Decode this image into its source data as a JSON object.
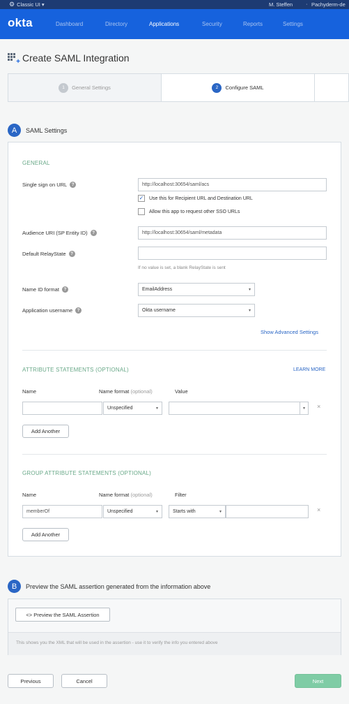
{
  "topbar": {
    "classic_label": "Classic UI ▾",
    "user": "M. Steffen",
    "separator": "·",
    "org": "Pachyderm-de"
  },
  "nav": {
    "logo": "okta",
    "items": [
      {
        "label": "Dashboard",
        "active": false
      },
      {
        "label": "Directory",
        "active": false
      },
      {
        "label": "Applications",
        "active": true
      },
      {
        "label": "Security",
        "active": false
      },
      {
        "label": "Reports",
        "active": false
      },
      {
        "label": "Settings",
        "active": false
      }
    ]
  },
  "page": {
    "title": "Create SAML Integration"
  },
  "steps": [
    {
      "num": "1",
      "label": "General Settings"
    },
    {
      "num": "2",
      "label": "Configure SAML"
    }
  ],
  "section_a": {
    "letter": "A",
    "label": "SAML Settings"
  },
  "general": {
    "title": "GENERAL",
    "sso_url_label": "Single sign on URL",
    "sso_url_value": "http://localhost:30654/saml/acs",
    "checkbox1_label": "Use this for Recipient URL and Destination URL",
    "checkbox1_mark": "✓",
    "checkbox2_label": "Allow this app to request other SSO URLs",
    "audience_label": "Audience URI (SP Entity ID)",
    "audience_value": "http://localhost:30654/saml/metadata",
    "relay_label": "Default RelayState",
    "relay_value": "",
    "relay_hint": "If no value is set, a blank RelayState is sent",
    "nameid_label": "Name ID format",
    "nameid_value": "EmailAddress",
    "appuser_label": "Application username",
    "appuser_value": "Okta username",
    "advanced_link": "Show Advanced Settings",
    "help_glyph": "?"
  },
  "attributes": {
    "title": "ATTRIBUTE STATEMENTS (OPTIONAL)",
    "learn_more": "LEARN MORE",
    "col_name": "Name",
    "col_format": "Name format",
    "col_format_opt": "(optional)",
    "col_value": "Value",
    "row_name": "",
    "row_format": "Unspecified",
    "row_value": "",
    "remove_glyph": "×",
    "add_another": "Add Another"
  },
  "group_attributes": {
    "title": "GROUP ATTRIBUTE STATEMENTS (OPTIONAL)",
    "col_name": "Name",
    "col_format": "Name format",
    "col_format_opt": "(optional)",
    "col_filter": "Filter",
    "row_name": "memberOf",
    "row_format": "Unspecified",
    "row_filter_type": "Starts with",
    "row_filter_value": "",
    "remove_glyph": "×",
    "add_another": "Add Another"
  },
  "section_b": {
    "letter": "B",
    "label": "Preview the SAML assertion generated from the information above",
    "preview_button": "<> Preview the SAML Assertion",
    "note": "This shows you the XML that will be used in the assertion - use it to verify the info you entered above"
  },
  "footer": {
    "previous": "Previous",
    "cancel": "Cancel",
    "next": "Next"
  },
  "colors": {
    "nav_bg": "#1662dd",
    "topbar_bg": "#1d3b73",
    "accent_blue": "#2a66c5",
    "section_green": "#6aa989",
    "next_button": "#7fcca5"
  },
  "caret_glyph": "▾"
}
